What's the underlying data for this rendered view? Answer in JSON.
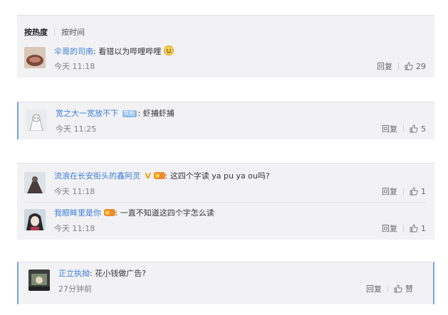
{
  "sort": {
    "active": "按热度",
    "inactive": "按时间"
  },
  "comments": [
    {
      "user": "伞哥的司南",
      "text": "看错以为哔哩哔哩",
      "time": "今天 11:18",
      "reply": "回复",
      "likes": "29"
    },
    {
      "user": "宽之大一宽放不下",
      "badge": "铁粉",
      "text": "虾捕虾捕",
      "time": "今天 11:25",
      "reply": "回复",
      "likes": "5"
    },
    {
      "user": "流浪在长安街头的鑫阿灵",
      "text": "这四个字读 ya pu ya ou吗?",
      "time": "今天 11:18",
      "reply": "回复",
      "likes": "1"
    },
    {
      "user": "我眼眸里是你",
      "text": "一直不知道这四个字怎么读",
      "time": "今天 11:18",
      "reply": "回复",
      "likes": "1"
    },
    {
      "user": "正立执拗",
      "text": "花小钱做广告?",
      "time": "27分钟前",
      "reply": "回复",
      "likes": "赞"
    }
  ],
  "colon": ":",
  "colors": {
    "link": "#3b7dd8",
    "accent": "#6da6e0",
    "card_bg": "#f2f2f5"
  },
  "icons": [
    "emoji-smile-icon",
    "thumbs-up-icon",
    "verified-v-icon",
    "fan-badge-icon"
  ]
}
